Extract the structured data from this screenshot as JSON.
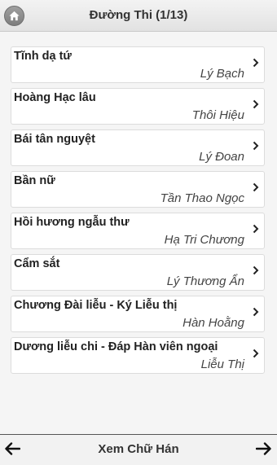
{
  "header": {
    "title": "Đường Thi (1/13)",
    "home_icon": "home-icon"
  },
  "poems": [
    {
      "title": "Tĩnh dạ tứ",
      "author": "Lý Bạch"
    },
    {
      "title": "Hoàng Hạc lâu",
      "author": "Thôi Hiệu"
    },
    {
      "title": "Bái tân nguyệt",
      "author": "Lý Đoan"
    },
    {
      "title": "Bần nữ",
      "author": "Tần Thao Ngọc"
    },
    {
      "title": "Hồi hương ngẫu thư",
      "author": "Hạ Tri Chương"
    },
    {
      "title": "Cẩm sắt",
      "author": "Lý Thương Ẩn"
    },
    {
      "title": "Chương Đài liễu - Ký Liễu thị",
      "author": "Hàn Hoằng"
    },
    {
      "title": "Dương liễu chi - Đáp Hàn viên ngoại",
      "author": "Liễu Thị"
    }
  ],
  "footer": {
    "center_label": "Xem Chữ Hán",
    "prev_icon": "arrow-left-icon",
    "next_icon": "arrow-right-icon"
  }
}
